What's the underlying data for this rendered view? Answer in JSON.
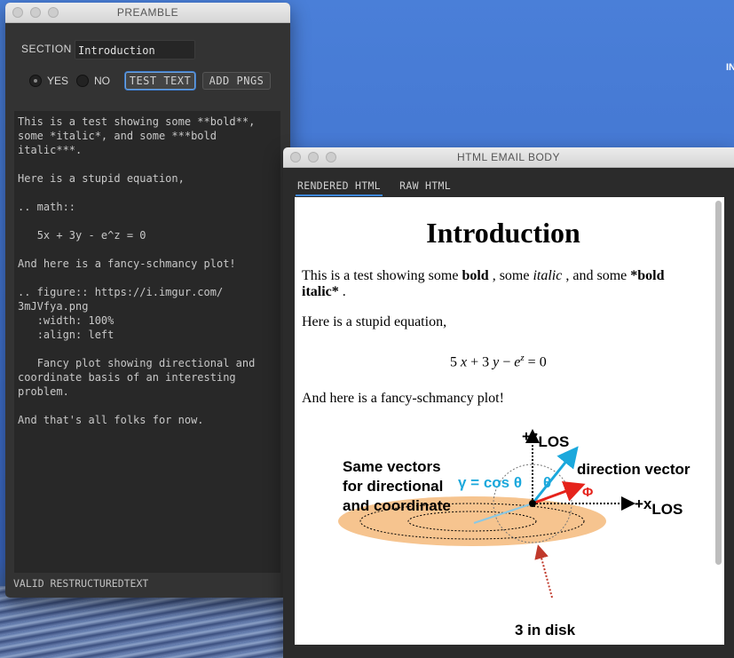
{
  "desktop": {
    "edge_text": "IN"
  },
  "preamble": {
    "title": "PREAMBLE",
    "section_label": "SECTION",
    "section_value": "Introduction",
    "yes_label": "YES",
    "no_label": "NO",
    "test_text_button": "TEST TEXT",
    "add_pngs_button": "ADD PNGS",
    "editor_text": "This is a test showing some **bold**,\nsome *italic*, and some ***bold\nitalic***.\n\nHere is a stupid equation,\n\n.. math::\n\n   5x + 3y - e^z = 0\n\nAnd here is a fancy-schmancy plot!\n\n.. figure:: https://i.imgur.com/\n3mJVfya.png\n   :width: 100%\n   :align: left\n\n   Fancy plot showing directional and\ncoordinate basis of an interesting\nproblem.\n\nAnd that's all folks for now.",
    "status": "VALID RESTRUCTUREDTEXT"
  },
  "email": {
    "title": "HTML EMAIL BODY",
    "tabs": [
      {
        "label": "RENDERED HTML"
      },
      {
        "label": "RAW HTML"
      }
    ],
    "doc": {
      "heading": "Introduction",
      "p1_a": "This is a test showing some ",
      "p1_bold": "bold",
      "p1_b": " , some ",
      "p1_italic": "italic",
      "p1_c": " , and some ",
      "p1_bolditalic": "*bold italic*",
      "p1_d": " .",
      "p2": "Here is a stupid equation,",
      "eq_a": "5",
      "eq_x": "x",
      "eq_plus": "+ 3",
      "eq_y": "y",
      "eq_minus": "−",
      "eq_e": "e",
      "eq_z": "z",
      "eq_rhs": "= 0",
      "p3": "And here is a fancy-schmancy plot!"
    },
    "figure": {
      "z_axis": "+z",
      "z_sub": "LOS",
      "x_axis": "+x",
      "x_sub": "LOS",
      "caption_line1": "Same vectors",
      "caption_line2": "for directional",
      "caption_line3": "and coordinate",
      "gamma_label": "γ = cos θ",
      "theta_label": "θ",
      "direction_label": "direction vector",
      "phi_label": "Φ",
      "disk_label": "3 in disk",
      "colors": {
        "disk": "#f6c48f",
        "blue": "#1ba8dc",
        "red": "#e5231b"
      }
    }
  }
}
